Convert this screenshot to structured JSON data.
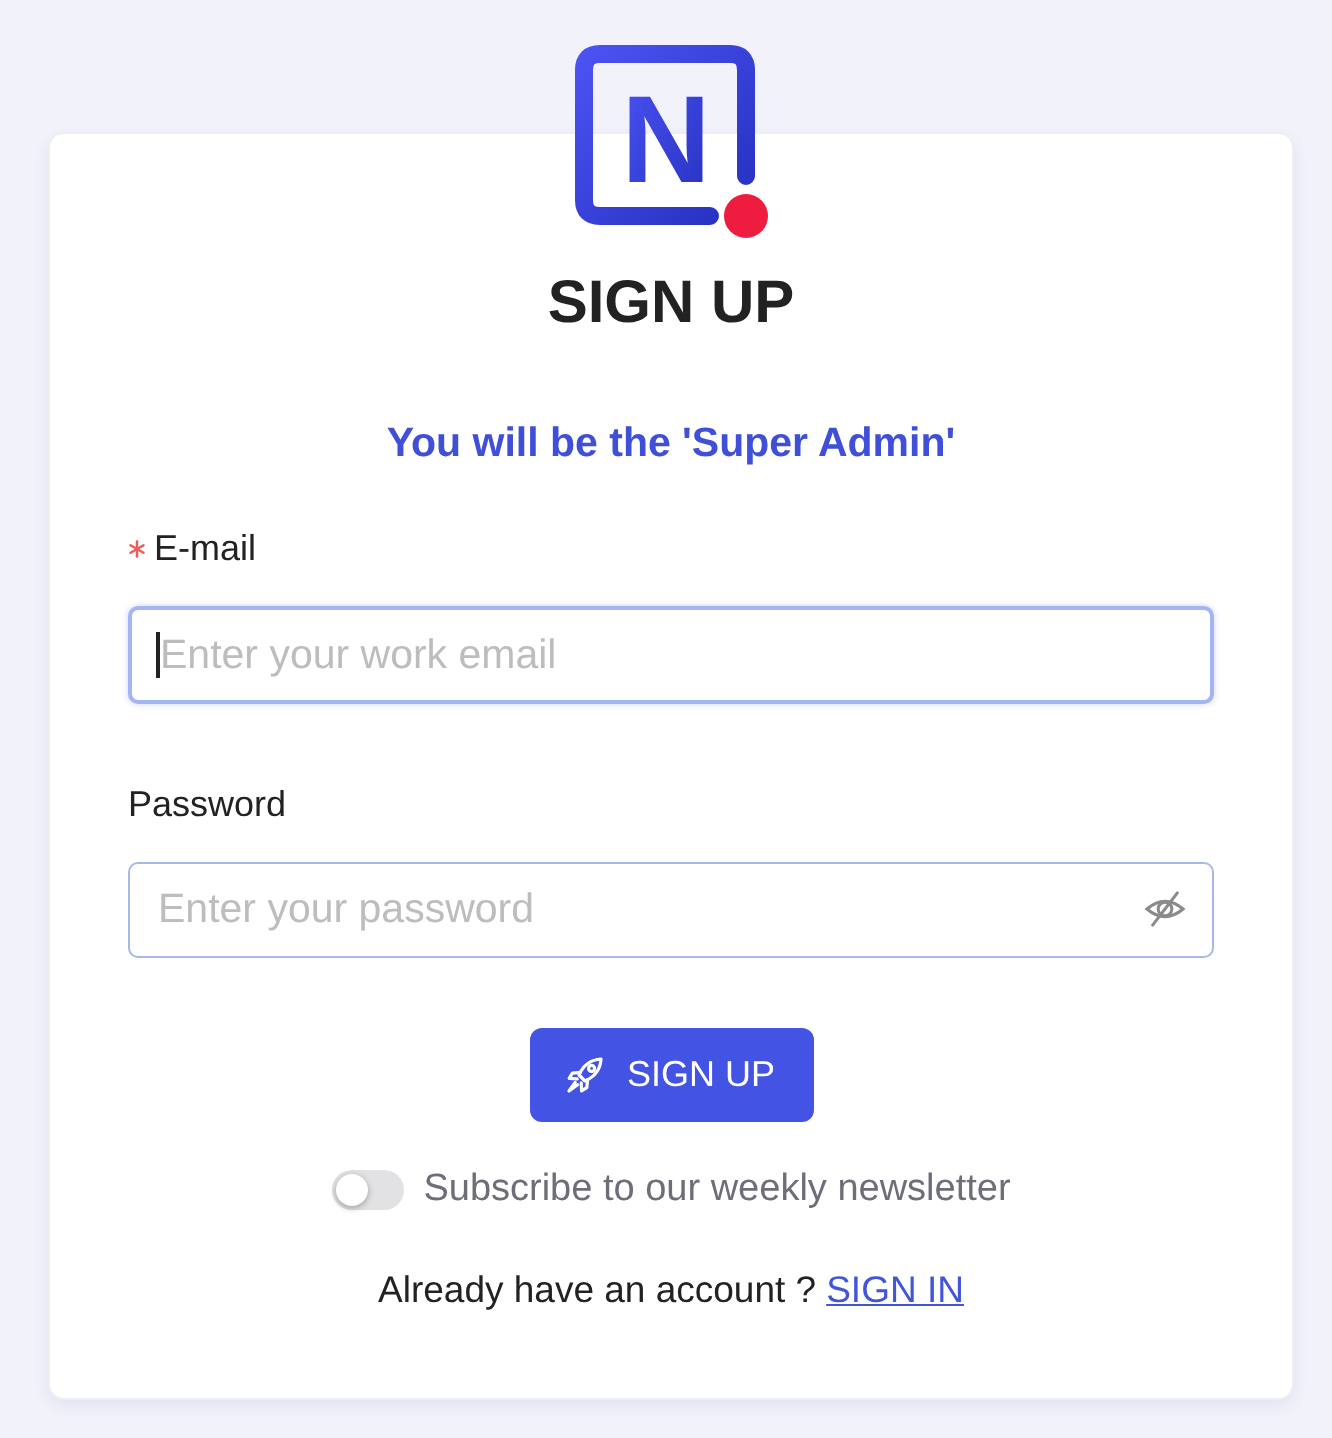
{
  "logo": {
    "letter": "N"
  },
  "title": "SIGN UP",
  "subtitle": "You will be the 'Super Admin'",
  "fields": [
    {
      "kind": "email",
      "label": "E-mail",
      "required": true,
      "placeholder": "Enter your work email",
      "focused": true
    },
    {
      "kind": "password",
      "label": "Password",
      "required": false,
      "placeholder": "Enter your password",
      "focused": false
    }
  ],
  "submit_button": {
    "label": "SIGN UP"
  },
  "newsletter_toggle": {
    "label": "Subscribe to our weekly newsletter",
    "on": false
  },
  "footer": {
    "text": "Already have an account ?",
    "link": "SIGN IN"
  }
}
